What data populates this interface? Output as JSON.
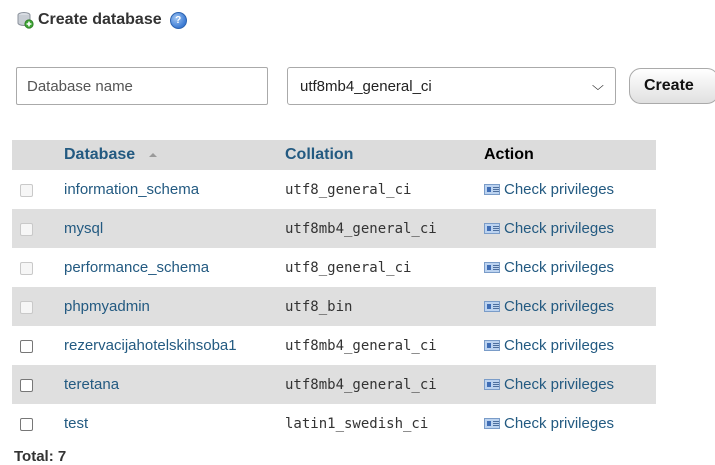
{
  "create_section": {
    "title": "Create database",
    "db_name_placeholder": "Database name",
    "collation_selected": "utf8mb4_general_ci",
    "create_button": "Create"
  },
  "table": {
    "headers": {
      "database": "Database",
      "collation": "Collation",
      "action": "Action"
    },
    "rows": [
      {
        "name": "information_schema",
        "collation": "utf8_general_ci",
        "action": "Check privileges",
        "checkbox_enabled": false
      },
      {
        "name": "mysql",
        "collation": "utf8mb4_general_ci",
        "action": "Check privileges",
        "checkbox_enabled": false
      },
      {
        "name": "performance_schema",
        "collation": "utf8_general_ci",
        "action": "Check privileges",
        "checkbox_enabled": false
      },
      {
        "name": "phpmyadmin",
        "collation": "utf8_bin",
        "action": "Check privileges",
        "checkbox_enabled": false
      },
      {
        "name": "rezervacijahotelskihsoba1",
        "collation": "utf8mb4_general_ci",
        "action": "Check privileges",
        "checkbox_enabled": true
      },
      {
        "name": "teretana",
        "collation": "utf8mb4_general_ci",
        "action": "Check privileges",
        "checkbox_enabled": true
      },
      {
        "name": "test",
        "collation": "latin1_swedish_ci",
        "action": "Check privileges",
        "checkbox_enabled": true
      }
    ]
  },
  "total_label": "Total: 7",
  "colors": {
    "link": "#235a81",
    "header_bg": "#dcdcdc",
    "even_row_bg": "#dfdfdf"
  },
  "icons": {
    "title_icon": "database-add-icon",
    "help_icon": "help-icon",
    "sort_icon": "sort-ascending-icon",
    "select_chevron": "chevron-down-icon",
    "privileges_icon": "privileges-icon"
  }
}
